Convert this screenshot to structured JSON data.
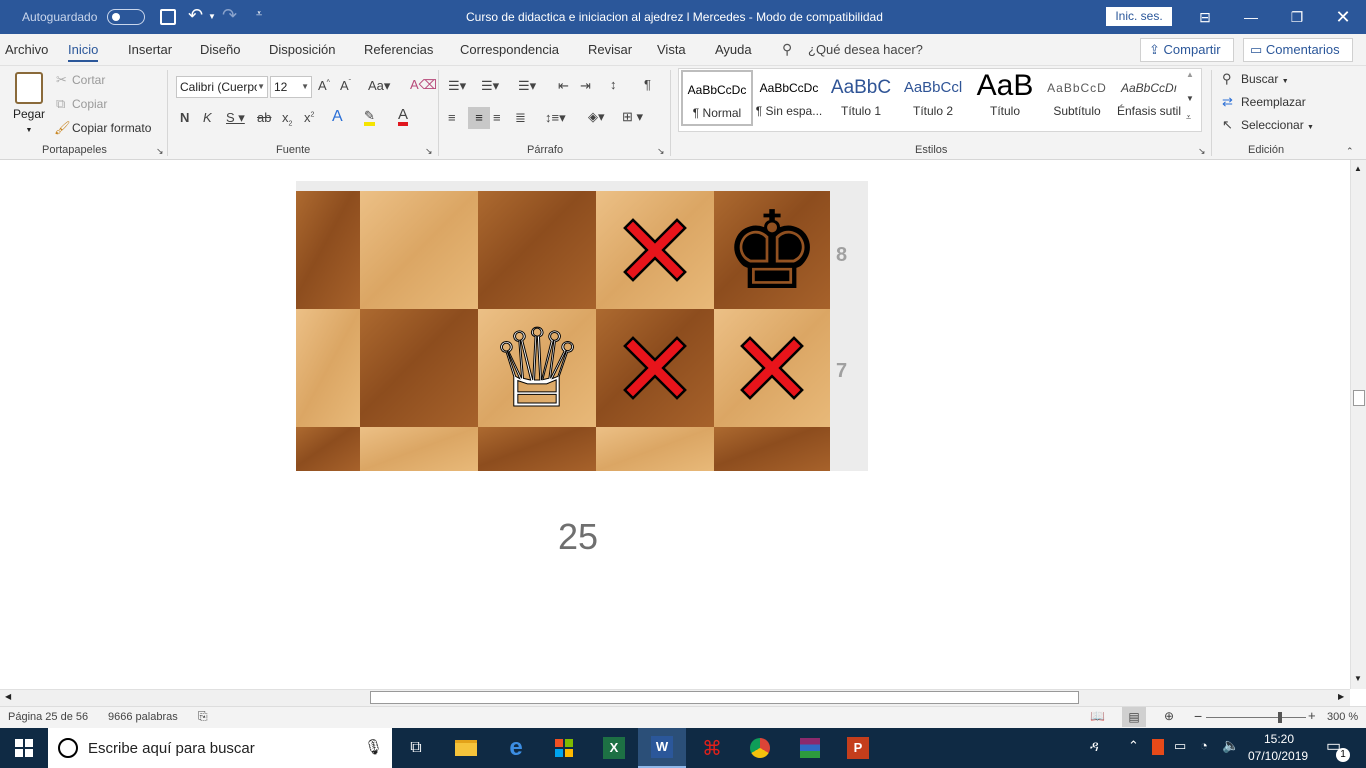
{
  "titlebar": {
    "autosave_label": "Autoguardado",
    "document_title": "Curso de didactica e iniciacion al ajedrez l Mercedes  -  Modo de compatibilidad",
    "signin_label": "Inic. ses."
  },
  "tabs": [
    "Archivo",
    "Inicio",
    "Insertar",
    "Diseño",
    "Disposición",
    "Referencias",
    "Correspondencia",
    "Revisar",
    "Vista",
    "Ayuda"
  ],
  "tell_me": "¿Qué desea hacer?",
  "share_label": "Compartir",
  "comments_label": "Comentarios",
  "clipboard": {
    "paste_label": "Pegar",
    "cut_label": "Cortar",
    "copy_label": "Copiar",
    "format_painter_label": "Copiar formato",
    "group_label": "Portapapeles"
  },
  "font": {
    "font_name": "Calibri (Cuerpo)",
    "font_size": "12",
    "group_label": "Fuente"
  },
  "paragraph": {
    "group_label": "Párrafo"
  },
  "styles": {
    "items": [
      {
        "preview": "AaBbCcDc",
        "name": "¶ Normal"
      },
      {
        "preview": "AaBbCcDc",
        "name": "¶ Sin espa..."
      },
      {
        "preview": "AaBbC",
        "name": "Título 1"
      },
      {
        "preview": "AaBbCcl",
        "name": "Título 2"
      },
      {
        "preview": "AaB",
        "name": "Título"
      },
      {
        "preview": "AaBbCcD",
        "name": "Subtítulo"
      },
      {
        "preview": "AaBbCcDı",
        "name": "Énfasis sutil"
      }
    ],
    "group_label": "Estilos"
  },
  "editing": {
    "find_label": "Buscar",
    "replace_label": "Reemplazar",
    "select_label": "Seleccionar",
    "group_label": "Edición"
  },
  "document": {
    "rank_labels": [
      "8",
      "7"
    ],
    "page_number": "25",
    "board": {
      "rows": [
        [
          "dark",
          "light",
          "dark",
          "light",
          "dark"
        ],
        [
          "light",
          "dark",
          "light",
          "dark",
          "light"
        ],
        [
          "dark",
          "light",
          "dark",
          "light",
          "dark"
        ]
      ],
      "pieces": [
        {
          "row": 0,
          "col": 4,
          "piece": "black-king",
          "glyph": "♚"
        },
        {
          "row": 1,
          "col": 2,
          "piece": "white-queen",
          "glyph": "♕"
        }
      ],
      "marks": [
        {
          "row": 0,
          "col": 3
        },
        {
          "row": 1,
          "col": 3
        },
        {
          "row": 1,
          "col": 4
        }
      ],
      "mark_color": "#e8141b"
    }
  },
  "status": {
    "page": "Página 25 de 56",
    "words": "9666 palabras",
    "zoom": "300 %"
  },
  "taskbar": {
    "search_placeholder": "Escribe aquí para buscar",
    "time": "15:20",
    "date": "07/10/2019",
    "notifications": "1"
  },
  "colors": {
    "word_blue": "#2b579a",
    "taskbar": "#0f2a44"
  }
}
